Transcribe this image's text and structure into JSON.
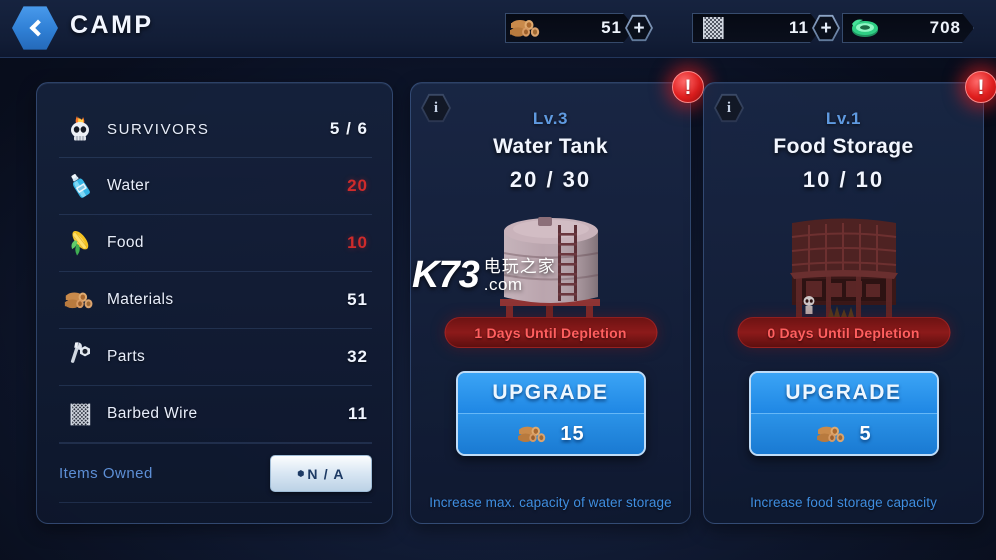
{
  "header": {
    "title": "CAMP",
    "back_icon": "back-chevron-icon"
  },
  "resources_bar": [
    {
      "icon": "materials-logs-icon",
      "value": "51",
      "add_label": "+"
    },
    {
      "icon": "barbed-wire-icon",
      "value": "11",
      "add_label": "+"
    },
    {
      "icon": "green-gem-icon",
      "value": "708"
    }
  ],
  "left_panel": {
    "rows": [
      {
        "icon": "skull-survivors-icon",
        "label": "SURVIVORS",
        "value": "5 / 6",
        "low": false
      },
      {
        "icon": "water-bottle-icon",
        "label": "Water",
        "value": "20",
        "low": true
      },
      {
        "icon": "corn-food-icon",
        "label": "Food",
        "value": "10",
        "low": true
      },
      {
        "icon": "materials-logs-icon",
        "label": "Materials",
        "value": "51",
        "low": false
      },
      {
        "icon": "wrench-parts-icon",
        "label": "Parts",
        "value": "32",
        "low": false
      },
      {
        "icon": "barbed-wire-icon",
        "label": "Barbed Wire",
        "value": "11",
        "low": false
      }
    ],
    "items_owned": {
      "label": "Items Owned",
      "button_value": "N / A"
    }
  },
  "cards": [
    {
      "id": "water-tank",
      "info_icon": "info-icon",
      "alert_icon": "alert-exclamation-icon",
      "level": "Lv.3",
      "name": "Water Tank",
      "capacity": "20 / 30",
      "art": "water-tank-building",
      "depletion": "1 Days Until Depletion",
      "upgrade_label": "UPGRADE",
      "upgrade_cost": "15",
      "upgrade_cost_icon": "materials-logs-icon",
      "description": "Increase max. capacity of water storage"
    },
    {
      "id": "food-storage",
      "info_icon": "info-icon",
      "alert_icon": "alert-exclamation-icon",
      "level": "Lv.1",
      "name": "Food Storage",
      "capacity": "10 / 10",
      "art": "food-storage-building",
      "depletion": "0 Days Until Depletion",
      "upgrade_label": "UPGRADE",
      "upgrade_cost": "5",
      "upgrade_cost_icon": "materials-logs-icon",
      "description": "Increase food storage capacity"
    }
  ],
  "watermark": {
    "brand": "K73",
    "chinese": "电玩之家",
    "domain": ".com"
  },
  "colors": {
    "accent_blue": "#3ba4f5",
    "level_blue": "#5f9ae0",
    "low_red": "#cf2b2b",
    "alert_red": "#e01f1f",
    "panel_bg": "#16223c",
    "desc_blue": "#3f8ee0"
  }
}
